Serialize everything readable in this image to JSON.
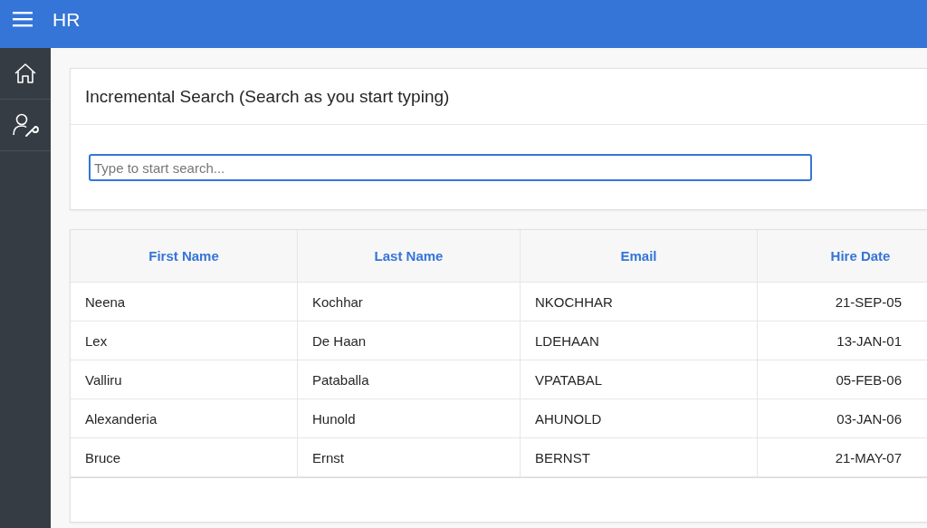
{
  "header": {
    "title": "HR"
  },
  "sidebar": {
    "items": [
      {
        "kind": "home"
      },
      {
        "kind": "admin"
      }
    ]
  },
  "search_region": {
    "title": "Incremental Search (Search as you start typing)",
    "search": {
      "placeholder": "Type to start search..."
    }
  },
  "table": {
    "columns": [
      {
        "label": "First Name"
      },
      {
        "label": "Last Name"
      },
      {
        "label": "Email"
      },
      {
        "label": "Hire Date"
      }
    ],
    "rows": [
      [
        "Neena",
        "Kochhar",
        "NKOCHHAR",
        "21-SEP-05"
      ],
      [
        "Lex",
        "De Haan",
        "LDEHAAN",
        "13-JAN-01"
      ],
      [
        "Valliru",
        "Pataballa",
        "VPATABAL",
        "05-FEB-06"
      ],
      [
        "Alexanderia",
        "Hunold",
        "AHUNOLD",
        "03-JAN-06"
      ],
      [
        "Bruce",
        "Ernst",
        "BERNST",
        "21-MAY-07"
      ]
    ]
  }
}
